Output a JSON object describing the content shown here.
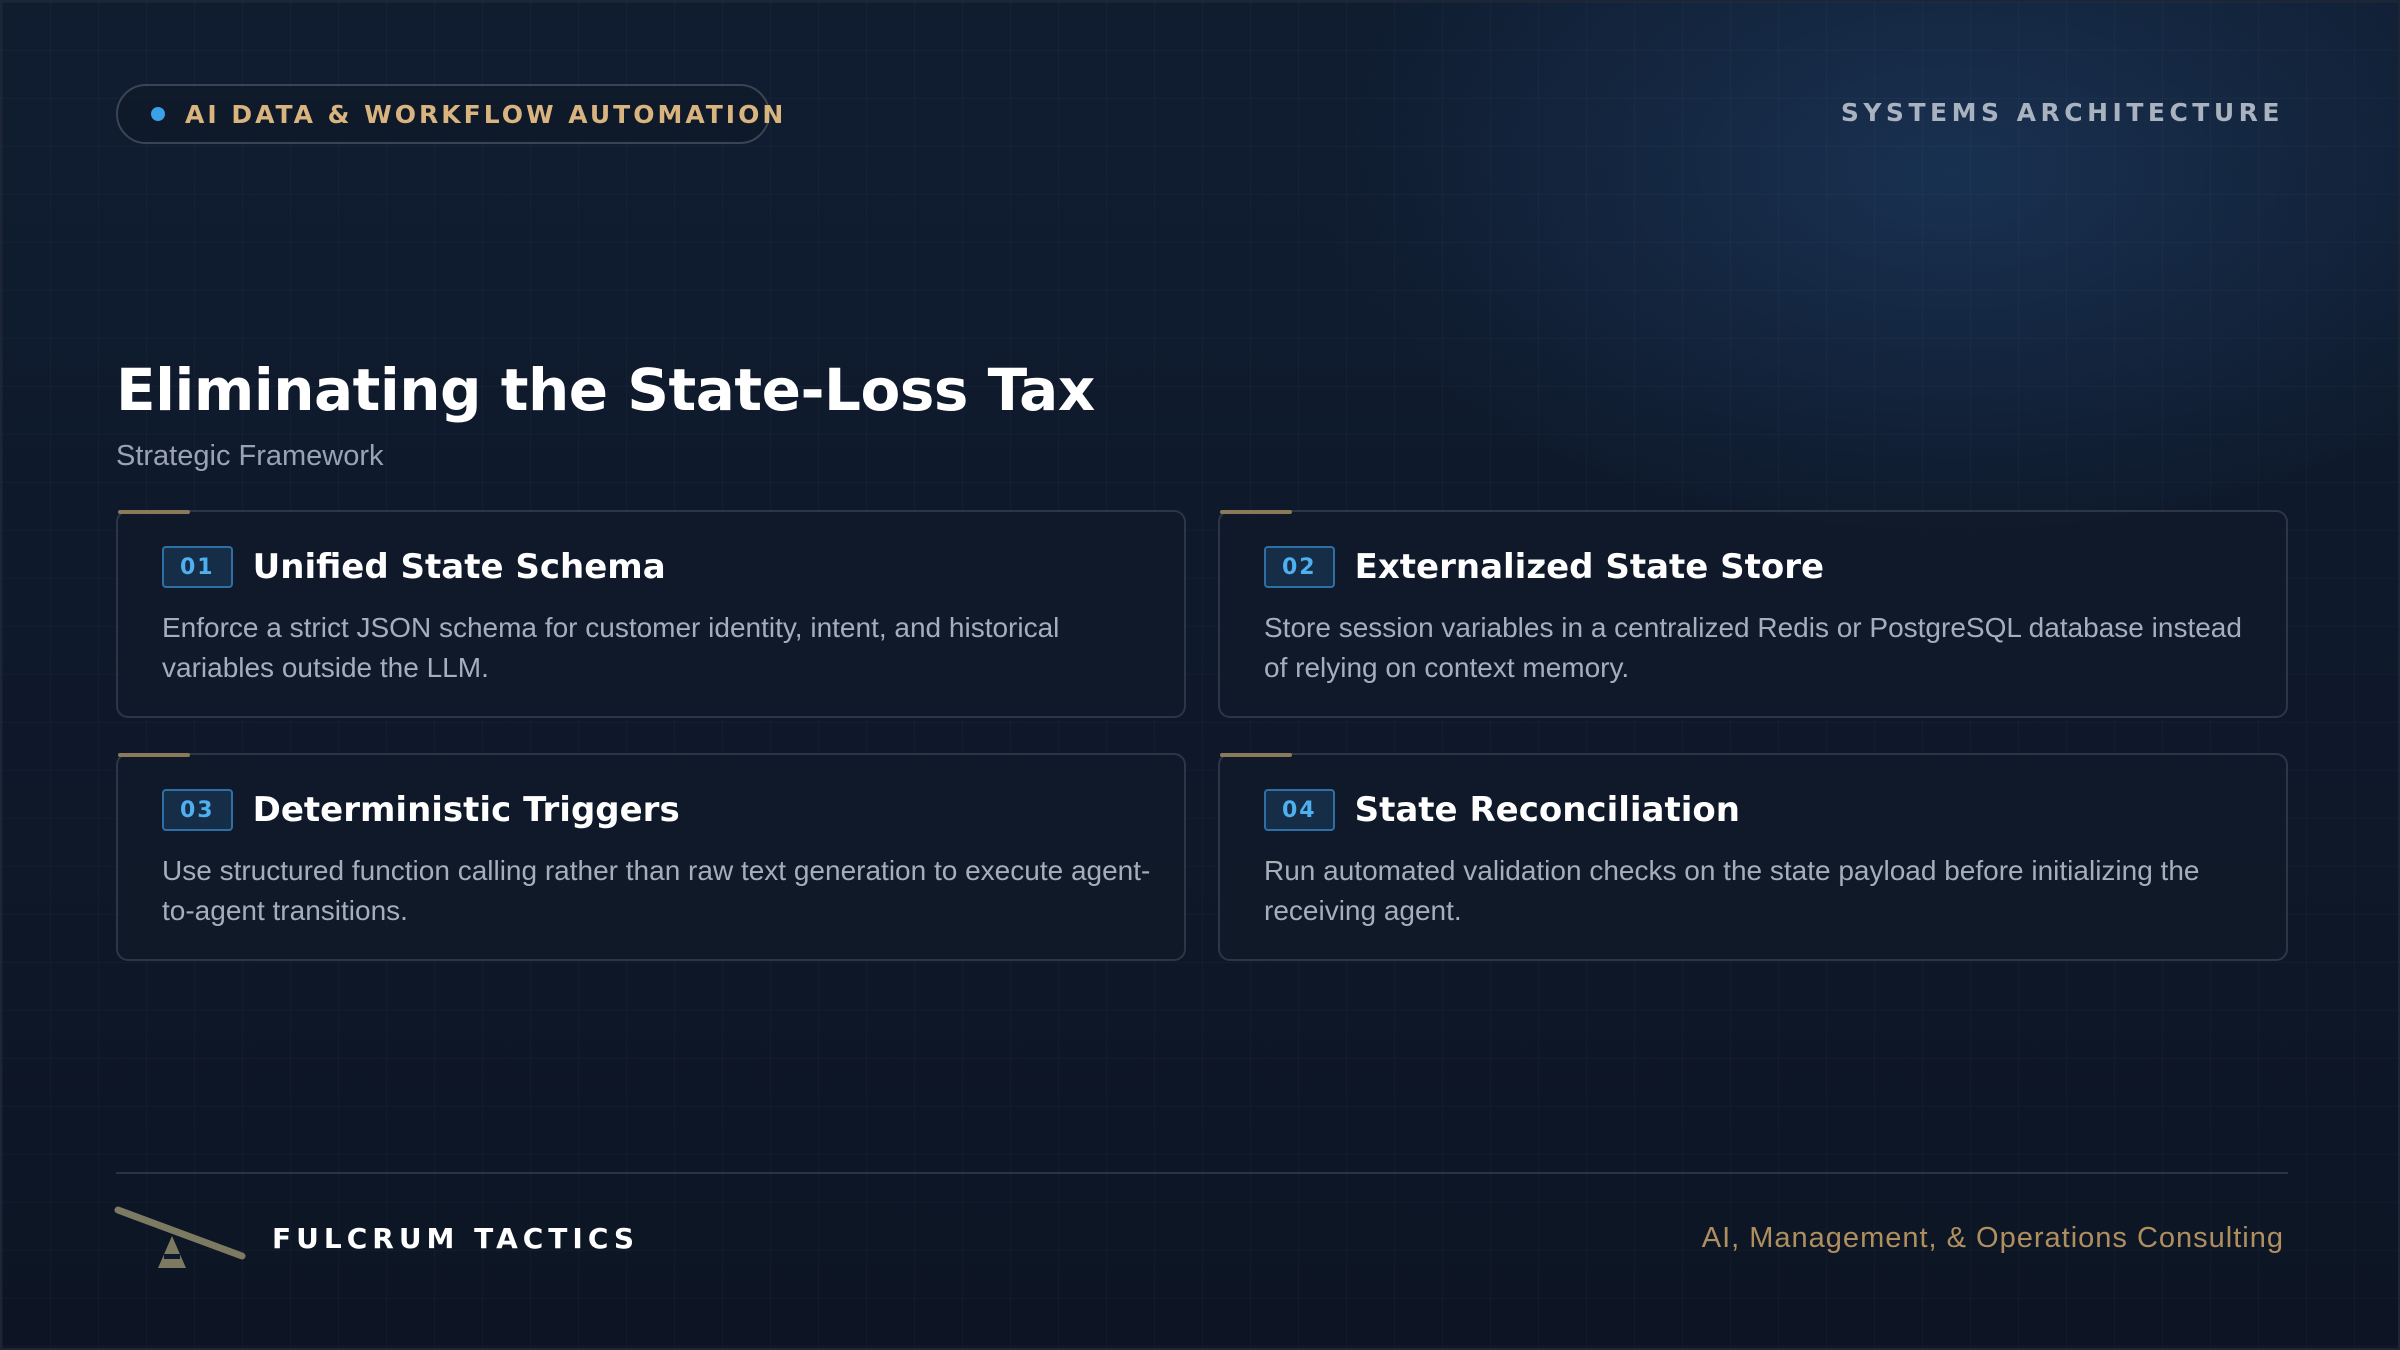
{
  "header": {
    "tag": "AI DATA & WORKFLOW AUTOMATION",
    "section": "SYSTEMS ARCHITECTURE"
  },
  "main": {
    "title": "Eliminating the State-Loss Tax",
    "subtitle": "Strategic Framework",
    "cards": [
      {
        "number": "01",
        "title": "Unified State Schema",
        "description": "Enforce a strict JSON schema for customer identity, intent, and historical variables outside the LLM."
      },
      {
        "number": "02",
        "title": "Externalized State Store",
        "description": "Store session variables in a centralized Redis or PostgreSQL database instead of relying on context memory."
      },
      {
        "number": "03",
        "title": "Deterministic Triggers",
        "description": "Use structured function calling rather than raw text generation to execute agent-to-agent transitions."
      },
      {
        "number": "04",
        "title": "State Reconciliation",
        "description": "Run automated validation checks on the state payload before initializing the receiving agent."
      }
    ]
  },
  "footer": {
    "brand": "FULCRUM TACTICS",
    "tagline": "AI, Management, & Operations Consulting",
    "logo_icon": "fulcrum-lever-icon"
  },
  "colors": {
    "background": "#0f1a2c",
    "accent_blue": "#3aa0e8",
    "accent_gold": "#d9b47f",
    "card_border": "#2d3646"
  }
}
